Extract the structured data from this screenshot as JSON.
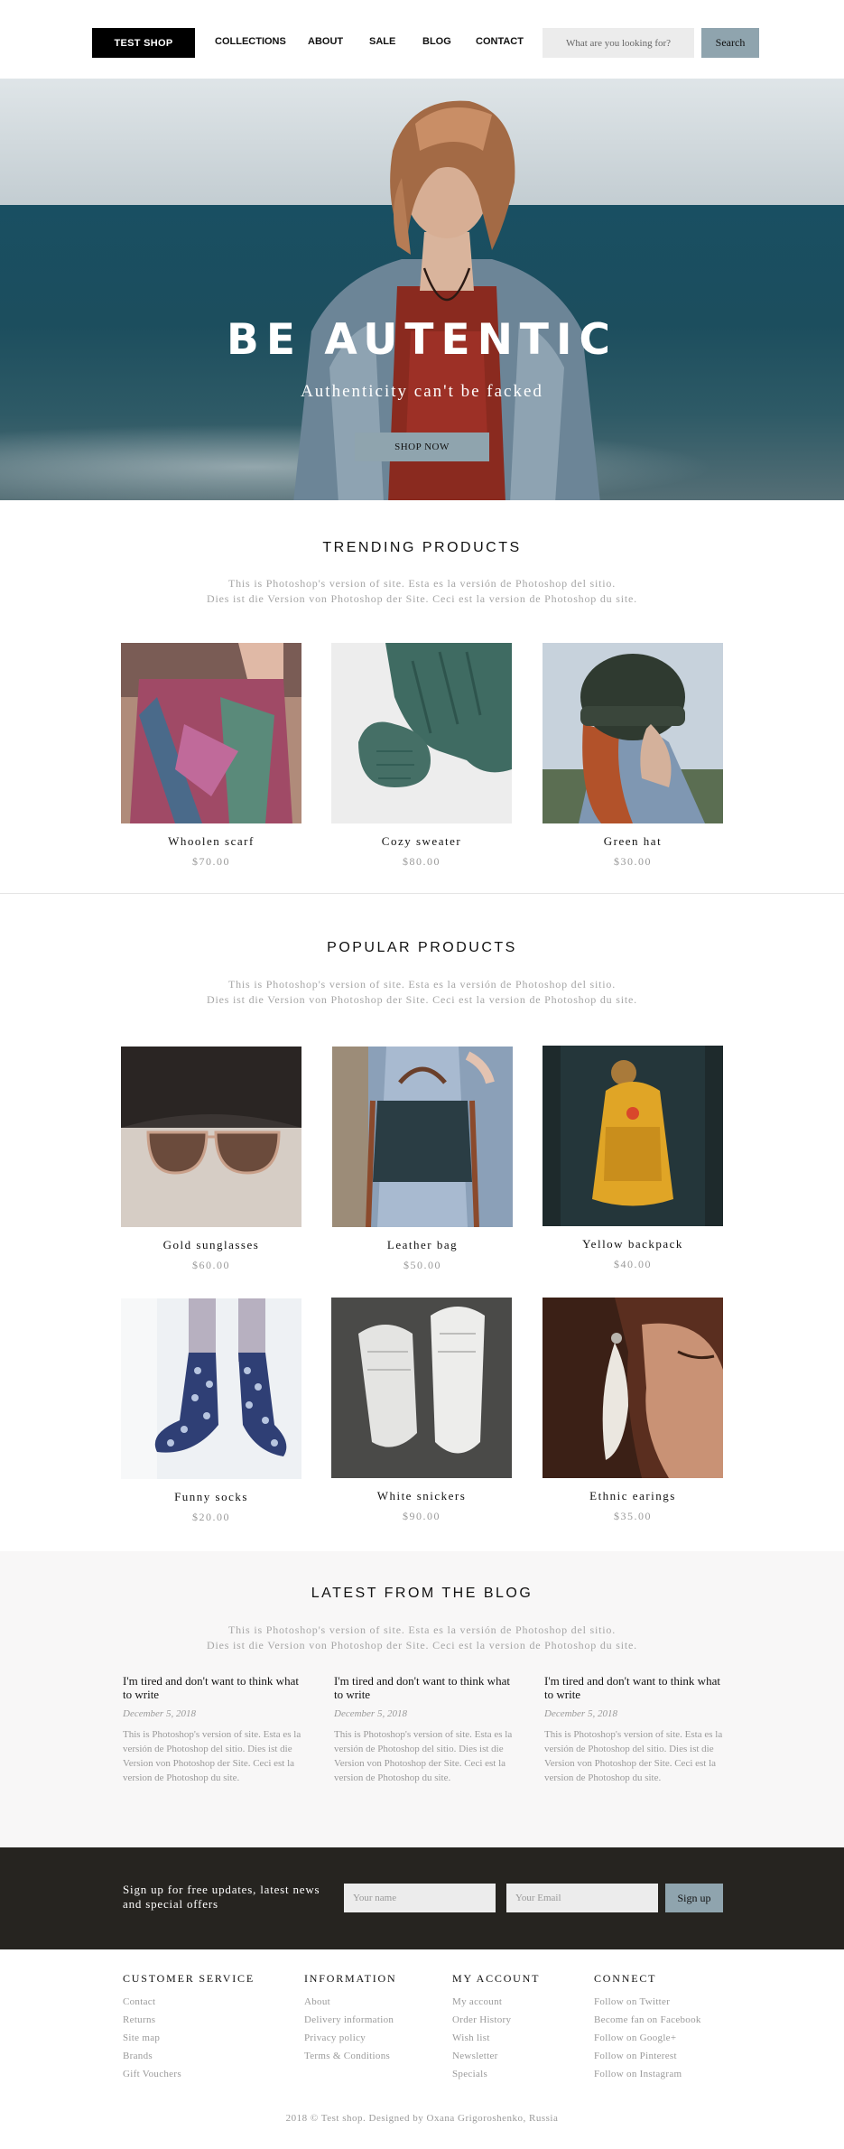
{
  "header": {
    "logo": "TEST SHOP",
    "nav": [
      "COLLECTIONS",
      "ABOUT",
      "SALE",
      "BLOG",
      "CONTACT"
    ],
    "search_placeholder": "What are you looking for?",
    "search_button": "Search"
  },
  "hero": {
    "title": "BE AUTENTIC",
    "subtitle": "Authenticity can't be facked",
    "button": "SHOP NOW"
  },
  "trending": {
    "title": "TRENDING PRODUCTS",
    "desc_line1": "This is Photoshop's version of site. Esta es la versión de Photoshop del sitio.",
    "desc_line2": "Dies ist die Version von Photoshop der Site. Ceci est la version de Photoshop du site.",
    "products": [
      {
        "name": "Whoolen scarf",
        "price": "$70.00"
      },
      {
        "name": "Cozy sweater",
        "price": "$80.00"
      },
      {
        "name": "Green hat",
        "price": "$30.00"
      }
    ]
  },
  "popular": {
    "title": "POPULAR PRODUCTS",
    "desc_line1": "This is Photoshop's version of site. Esta es la versión de Photoshop del sitio.",
    "desc_line2": "Dies ist die Version von Photoshop der Site. Ceci est la version de Photoshop du site.",
    "products": [
      {
        "name": "Gold sunglasses",
        "price": "$60.00"
      },
      {
        "name": "Leather bag",
        "price": "$50.00"
      },
      {
        "name": "Yellow backpack",
        "price": "$40.00"
      },
      {
        "name": "Funny socks",
        "price": "$20.00"
      },
      {
        "name": "White snickers",
        "price": "$90.00"
      },
      {
        "name": "Ethnic earings",
        "price": "$35.00"
      }
    ]
  },
  "blog": {
    "title": "LATEST FROM THE BLOG",
    "desc_line1": "This is Photoshop's version of site. Esta es la versión de Photoshop del sitio.",
    "desc_line2": "Dies ist die Version von Photoshop der Site. Ceci est la version de Photoshop du site.",
    "posts": [
      {
        "title": "I'm tired and don't want to think what to write",
        "date": "December 5, 2018",
        "text": "This is Photoshop's version of site. Esta es la versión de Photoshop del sitio. Dies ist die Version von Photoshop der Site. Ceci est la version de Photoshop du site."
      },
      {
        "title": "I'm tired and don't want to think what to write",
        "date": "December 5, 2018",
        "text": "This is Photoshop's version of site. Esta es la versión de Photoshop del sitio. Dies ist die Version von Photoshop der Site. Ceci est la version de Photoshop du site."
      },
      {
        "title": "I'm tired and don't want to think what to write",
        "date": "December 5, 2018",
        "text": "This is Photoshop's version of site. Esta es la versión de Photoshop del sitio. Dies ist die Version von Photoshop der Site. Ceci est la version de Photoshop du site."
      }
    ]
  },
  "newsletter": {
    "text": "Sign up for free updates, latest news and special offers",
    "name_placeholder": "Your name",
    "email_placeholder": "Your Email",
    "button": "Sign up"
  },
  "footer": {
    "columns": [
      {
        "heading": "CUSTOMER SERVICE",
        "links": [
          "Contact",
          "Returns",
          "Site map",
          "Brands",
          "Gift Vouchers"
        ]
      },
      {
        "heading": "INFORMATION",
        "links": [
          "About",
          "Delivery information",
          "Privacy policy",
          "Terms & Conditions"
        ]
      },
      {
        "heading": "MY ACCOUNT",
        "links": [
          "My account",
          "Order History",
          "Wish list",
          "Newsletter",
          "Specials"
        ]
      },
      {
        "heading": "CONNECT",
        "links": [
          "Follow on Twitter",
          "Become fan on Facebook",
          "Follow on Google+",
          "Follow on Pinterest",
          "Follow on Instagram"
        ]
      }
    ],
    "copyright": "2018 © Test shop. Designed by Oxana Grigoroshenko, Russia"
  },
  "colors": {
    "accent": "#8fa4ae",
    "dark": "#262420",
    "muted": "#9a9a9a"
  }
}
